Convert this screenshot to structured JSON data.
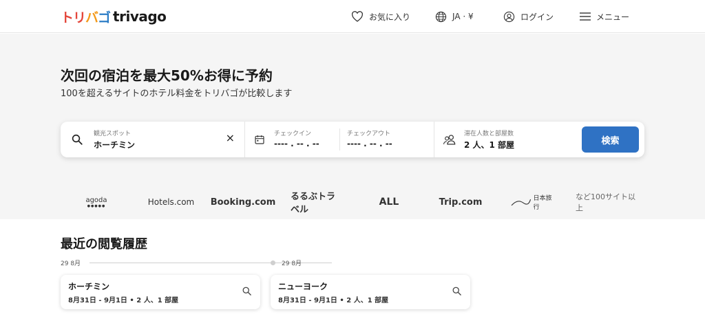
{
  "header": {
    "logo_jp_1": "トリ",
    "logo_jp_2": "バ",
    "logo_jp_3": "ゴ",
    "logo_en": "trivago",
    "favorites": "お気に入り",
    "language": "JA · ¥",
    "login": "ログイン",
    "menu": "メニュー"
  },
  "hero": {
    "title": "次回の宿泊を最大50%お得に予約",
    "subtitle": "100を超えるサイトのホテル料金をトリバゴが比較します"
  },
  "search": {
    "destination_label": "観光スポット",
    "destination_value": "ホーチミン",
    "clear": "×",
    "checkin_label": "チェックイン",
    "checkin_value": "---- . -- . --",
    "checkout_label": "チェックアウト",
    "checkout_value": "---- . -- . --",
    "guests_label": "滞在人数と部屋数",
    "guests_value": "2 人、1 部屋",
    "button": "検索"
  },
  "partners": {
    "agoda": "agoda",
    "agoda_dots": "●●●●●",
    "hotels": "Hotels.com",
    "booking": "Booking.com",
    "rurubu": "るるぶトラベル",
    "all": "ALL",
    "trip": "Trip.com",
    "nippon": "日本旅行",
    "more": "など100サイト以上"
  },
  "recent": {
    "title": "最近の閲覧履歴",
    "date_1": "29 8月",
    "date_2": "29 8月",
    "items": [
      {
        "name": "ホーチミン",
        "detail": "8月31日 - 9月1日 • 2 人、1 部屋"
      },
      {
        "name": "ニューヨーク",
        "detail": "8月31日 - 9月1日 • 2 人、1 部屋"
      }
    ]
  },
  "colors": {
    "brand_red": "#e4463b",
    "brand_orange": "#f39a1b",
    "brand_blue": "#2d7dc6",
    "search_button": "#2f72c4"
  }
}
